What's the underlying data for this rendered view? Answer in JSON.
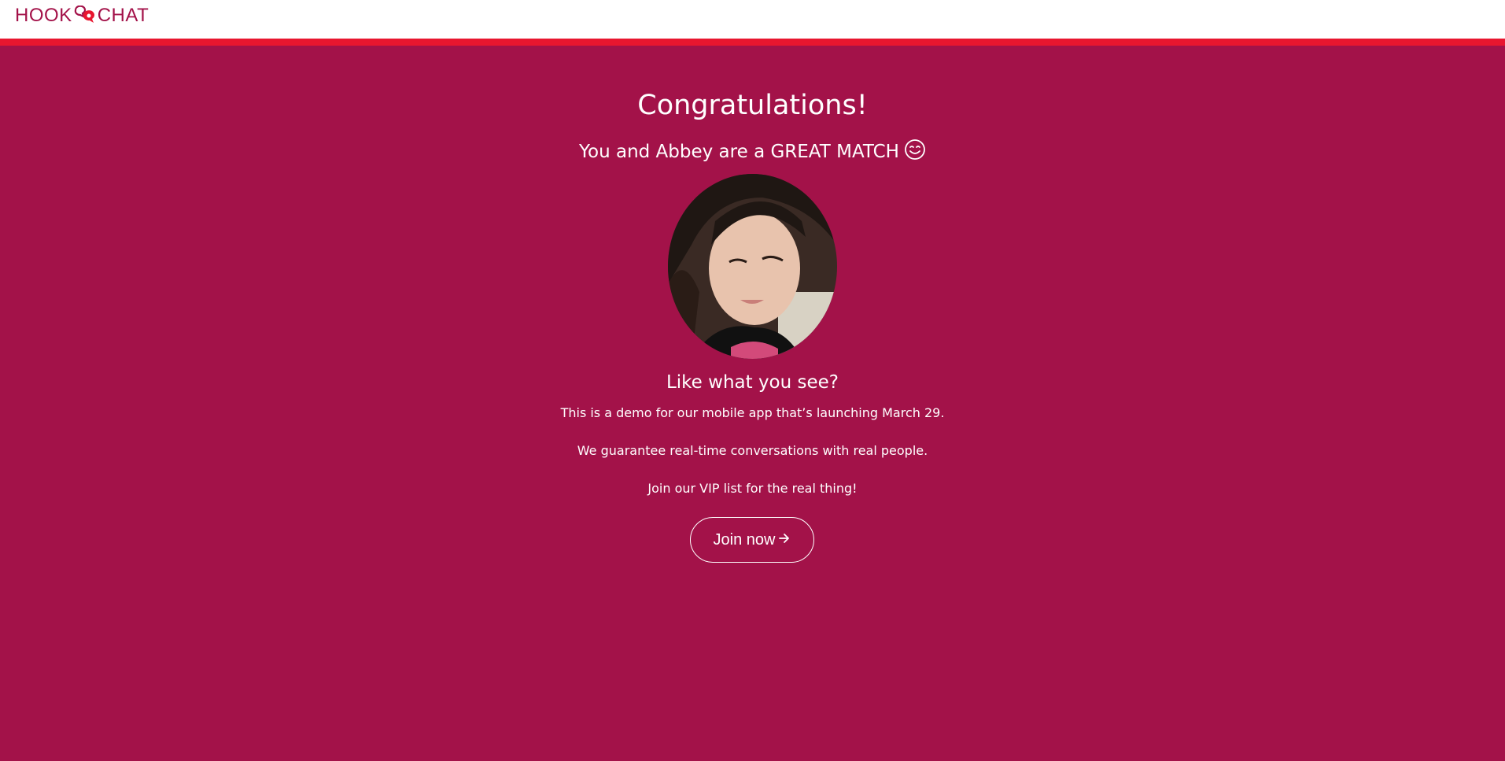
{
  "header": {
    "logo_left": "HOOK",
    "logo_right": "CHAT",
    "logo_icon": "chat-bubbles-icon"
  },
  "colors": {
    "background": "#a31249",
    "stripe": "#e8162f",
    "header_bg": "#ffffff",
    "text": "#ffffff"
  },
  "main": {
    "title": "Congratulations!",
    "subtitle": "You and Abbey are a GREAT MATCH",
    "subtitle_icon": "wink-face-icon",
    "lead": "Like what you see?",
    "paragraphs": [
      "This is a demo for our mobile app that’s launching March 29.",
      "We guarantee real-time conversations with real people.",
      "Join our VIP list for the real thing!"
    ],
    "cta_label": "Join now",
    "cta_icon": "arrow-right-icon"
  }
}
